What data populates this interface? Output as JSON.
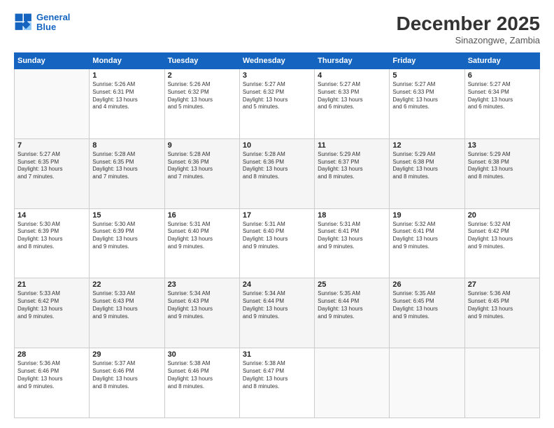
{
  "header": {
    "logo_line1": "General",
    "logo_line2": "Blue",
    "month": "December 2025",
    "location": "Sinazongwe, Zambia"
  },
  "days_of_week": [
    "Sunday",
    "Monday",
    "Tuesday",
    "Wednesday",
    "Thursday",
    "Friday",
    "Saturday"
  ],
  "weeks": [
    [
      {
        "day": "",
        "info": ""
      },
      {
        "day": "1",
        "info": "Sunrise: 5:26 AM\nSunset: 6:31 PM\nDaylight: 13 hours\nand 4 minutes."
      },
      {
        "day": "2",
        "info": "Sunrise: 5:26 AM\nSunset: 6:32 PM\nDaylight: 13 hours\nand 5 minutes."
      },
      {
        "day": "3",
        "info": "Sunrise: 5:27 AM\nSunset: 6:32 PM\nDaylight: 13 hours\nand 5 minutes."
      },
      {
        "day": "4",
        "info": "Sunrise: 5:27 AM\nSunset: 6:33 PM\nDaylight: 13 hours\nand 6 minutes."
      },
      {
        "day": "5",
        "info": "Sunrise: 5:27 AM\nSunset: 6:33 PM\nDaylight: 13 hours\nand 6 minutes."
      },
      {
        "day": "6",
        "info": "Sunrise: 5:27 AM\nSunset: 6:34 PM\nDaylight: 13 hours\nand 6 minutes."
      }
    ],
    [
      {
        "day": "7",
        "info": "Sunrise: 5:27 AM\nSunset: 6:35 PM\nDaylight: 13 hours\nand 7 minutes."
      },
      {
        "day": "8",
        "info": "Sunrise: 5:28 AM\nSunset: 6:35 PM\nDaylight: 13 hours\nand 7 minutes."
      },
      {
        "day": "9",
        "info": "Sunrise: 5:28 AM\nSunset: 6:36 PM\nDaylight: 13 hours\nand 7 minutes."
      },
      {
        "day": "10",
        "info": "Sunrise: 5:28 AM\nSunset: 6:36 PM\nDaylight: 13 hours\nand 8 minutes."
      },
      {
        "day": "11",
        "info": "Sunrise: 5:29 AM\nSunset: 6:37 PM\nDaylight: 13 hours\nand 8 minutes."
      },
      {
        "day": "12",
        "info": "Sunrise: 5:29 AM\nSunset: 6:38 PM\nDaylight: 13 hours\nand 8 minutes."
      },
      {
        "day": "13",
        "info": "Sunrise: 5:29 AM\nSunset: 6:38 PM\nDaylight: 13 hours\nand 8 minutes."
      }
    ],
    [
      {
        "day": "14",
        "info": "Sunrise: 5:30 AM\nSunset: 6:39 PM\nDaylight: 13 hours\nand 8 minutes."
      },
      {
        "day": "15",
        "info": "Sunrise: 5:30 AM\nSunset: 6:39 PM\nDaylight: 13 hours\nand 9 minutes."
      },
      {
        "day": "16",
        "info": "Sunrise: 5:31 AM\nSunset: 6:40 PM\nDaylight: 13 hours\nand 9 minutes."
      },
      {
        "day": "17",
        "info": "Sunrise: 5:31 AM\nSunset: 6:40 PM\nDaylight: 13 hours\nand 9 minutes."
      },
      {
        "day": "18",
        "info": "Sunrise: 5:31 AM\nSunset: 6:41 PM\nDaylight: 13 hours\nand 9 minutes."
      },
      {
        "day": "19",
        "info": "Sunrise: 5:32 AM\nSunset: 6:41 PM\nDaylight: 13 hours\nand 9 minutes."
      },
      {
        "day": "20",
        "info": "Sunrise: 5:32 AM\nSunset: 6:42 PM\nDaylight: 13 hours\nand 9 minutes."
      }
    ],
    [
      {
        "day": "21",
        "info": "Sunrise: 5:33 AM\nSunset: 6:42 PM\nDaylight: 13 hours\nand 9 minutes."
      },
      {
        "day": "22",
        "info": "Sunrise: 5:33 AM\nSunset: 6:43 PM\nDaylight: 13 hours\nand 9 minutes."
      },
      {
        "day": "23",
        "info": "Sunrise: 5:34 AM\nSunset: 6:43 PM\nDaylight: 13 hours\nand 9 minutes."
      },
      {
        "day": "24",
        "info": "Sunrise: 5:34 AM\nSunset: 6:44 PM\nDaylight: 13 hours\nand 9 minutes."
      },
      {
        "day": "25",
        "info": "Sunrise: 5:35 AM\nSunset: 6:44 PM\nDaylight: 13 hours\nand 9 minutes."
      },
      {
        "day": "26",
        "info": "Sunrise: 5:35 AM\nSunset: 6:45 PM\nDaylight: 13 hours\nand 9 minutes."
      },
      {
        "day": "27",
        "info": "Sunrise: 5:36 AM\nSunset: 6:45 PM\nDaylight: 13 hours\nand 9 minutes."
      }
    ],
    [
      {
        "day": "28",
        "info": "Sunrise: 5:36 AM\nSunset: 6:46 PM\nDaylight: 13 hours\nand 9 minutes."
      },
      {
        "day": "29",
        "info": "Sunrise: 5:37 AM\nSunset: 6:46 PM\nDaylight: 13 hours\nand 8 minutes."
      },
      {
        "day": "30",
        "info": "Sunrise: 5:38 AM\nSunset: 6:46 PM\nDaylight: 13 hours\nand 8 minutes."
      },
      {
        "day": "31",
        "info": "Sunrise: 5:38 AM\nSunset: 6:47 PM\nDaylight: 13 hours\nand 8 minutes."
      },
      {
        "day": "",
        "info": ""
      },
      {
        "day": "",
        "info": ""
      },
      {
        "day": "",
        "info": ""
      }
    ]
  ]
}
